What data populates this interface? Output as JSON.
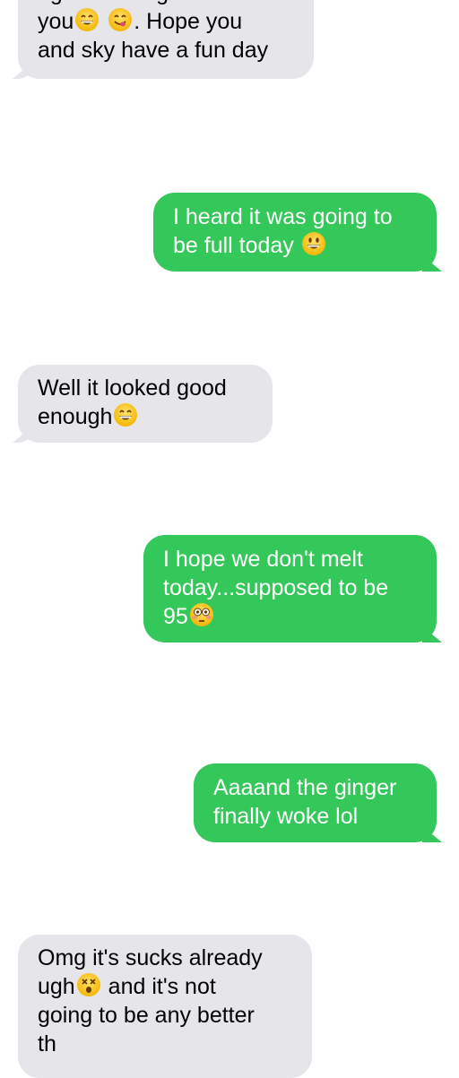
{
  "messages": [
    {
      "direction": "incoming",
      "lines": [
        "ng and thought of",
        "you",
        ". Hope you",
        "and sky have a fun day"
      ],
      "emojis": [
        "grinning-face-with-smiling-eyes",
        "face-savoring-food"
      ]
    },
    {
      "direction": "outgoing",
      "lines": [
        "I heard it was going to",
        "be full today"
      ],
      "emojis": [
        "grinning-face-with-big-eyes"
      ]
    },
    {
      "direction": "incoming",
      "lines": [
        "Well it looked good",
        "enough"
      ],
      "emojis": [
        "grinning-face-with-smiling-eyes"
      ]
    },
    {
      "direction": "outgoing",
      "lines": [
        "I hope we don't melt",
        "today...supposed to be",
        "95"
      ],
      "emojis": [
        "flushed-face"
      ]
    },
    {
      "direction": "outgoing",
      "lines": [
        "Aaaand the ginger",
        "finally woke lol"
      ],
      "emojis": []
    },
    {
      "direction": "incoming",
      "lines": [
        "Omg it's sucks already",
        "ugh",
        "and it's not",
        "going to be any better",
        "th"
      ],
      "emojis": [
        "dizzy-face"
      ]
    }
  ],
  "colors": {
    "incoming_bubble": "#e5e5ea",
    "outgoing_bubble": "#34c759"
  }
}
